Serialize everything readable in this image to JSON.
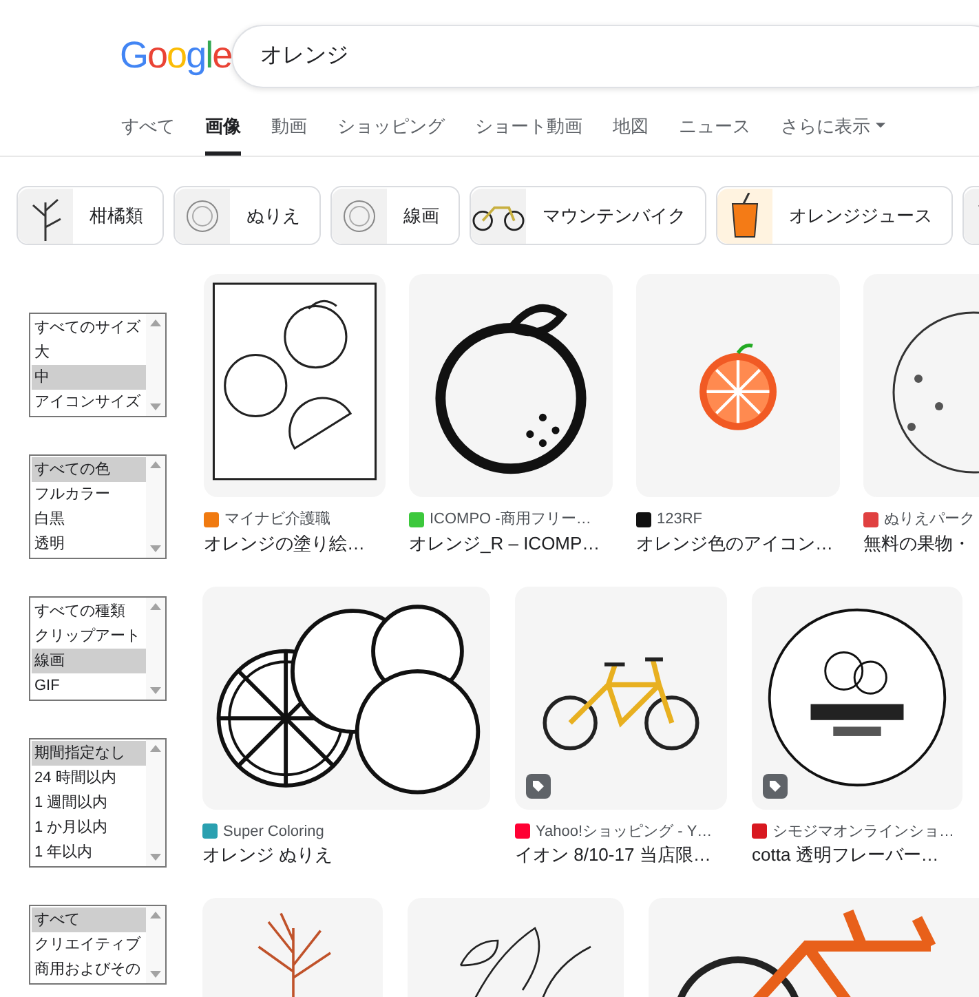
{
  "logo": "Google",
  "search": {
    "value": "オレンジ"
  },
  "tabs": [
    {
      "label": "すべて",
      "selected": false
    },
    {
      "label": "画像",
      "selected": true
    },
    {
      "label": "動画",
      "selected": false
    },
    {
      "label": "ショッピング",
      "selected": false
    },
    {
      "label": "ショート動画",
      "selected": false
    },
    {
      "label": "地図",
      "selected": false
    },
    {
      "label": "ニュース",
      "selected": false
    },
    {
      "label": "さらに表示",
      "selected": false,
      "kind": "menu"
    }
  ],
  "chips": [
    {
      "label": "柑橘類",
      "kind": "plant"
    },
    {
      "label": "ぬりえ",
      "kind": "orange"
    },
    {
      "label": "線画",
      "kind": "orange"
    },
    {
      "label": "マウンテンバイク",
      "kind": "bicycle"
    },
    {
      "label": "オレンジジュース",
      "kind": "juice"
    },
    {
      "kind": "plant"
    }
  ],
  "filters": [
    {
      "options": [
        {
          "label": "すべてのサイズ",
          "selected": false
        },
        {
          "label": "大",
          "selected": false
        },
        {
          "label": "中",
          "selected": true
        },
        {
          "label": "アイコンサイズ",
          "selected": false
        }
      ]
    },
    {
      "options": [
        {
          "label": "すべての色",
          "selected": true
        },
        {
          "label": "フルカラー",
          "selected": false
        },
        {
          "label": "白黒",
          "selected": false
        },
        {
          "label": "透明",
          "selected": false
        }
      ]
    },
    {
      "options": [
        {
          "label": "すべての種類",
          "selected": false
        },
        {
          "label": "クリップアート",
          "selected": false
        },
        {
          "label": "線画",
          "selected": true
        },
        {
          "label": "GIF",
          "selected": false
        }
      ]
    },
    {
      "options": [
        {
          "label": "期間指定なし",
          "selected": true
        },
        {
          "label": "24 時間以内",
          "selected": false
        },
        {
          "label": "1 週間以内",
          "selected": false
        },
        {
          "label": "1 か月以内",
          "selected": false
        },
        {
          "label": "1 年以内",
          "selected": false
        }
      ]
    },
    {
      "options": [
        {
          "label": "すべて",
          "selected": true
        },
        {
          "label": "クリエイティブ",
          "selected": false
        },
        {
          "label": "商用およびその",
          "selected": false
        }
      ]
    }
  ],
  "results": [
    [
      {
        "kind": "coloring-page",
        "source": "マイナビ介護職",
        "color": "#f07a10",
        "title": "オレンジの塗り絵…",
        "tag": false
      },
      {
        "kind": "orange-outline",
        "source": "ICOMPO -商用フリー…",
        "color": "#3cc83c",
        "title": "オレンジ_R – ICOMP…",
        "tag": false
      },
      {
        "kind": "orange-slice",
        "source": "123RF",
        "color": "#111111",
        "title": "オレンジ色のアイコン…",
        "tag": false
      },
      {
        "kind": "orange-fruit",
        "source": "ぬりえパーク",
        "color": "#e04040",
        "title": "無料の果物・",
        "tag": false
      }
    ],
    [
      {
        "kind": "oranges",
        "source": "Super Coloring",
        "color": "#2aa0b0",
        "title": "オレンジ ぬりえ",
        "tag": false
      },
      {
        "kind": "bicycle",
        "source": "Yahoo!ショッピング - Y…",
        "color": "#ff0033",
        "title": "イオン 8/10-17 当店限…",
        "tag": true
      },
      {
        "kind": "label",
        "source": "シモジマオンラインショ…",
        "color": "#d81820",
        "title": "cotta 透明フレーバー…",
        "tag": true
      }
    ],
    [
      {
        "kind": "plant"
      },
      {
        "kind": "flower"
      },
      {
        "kind": "bicycle-photo"
      }
    ]
  ]
}
